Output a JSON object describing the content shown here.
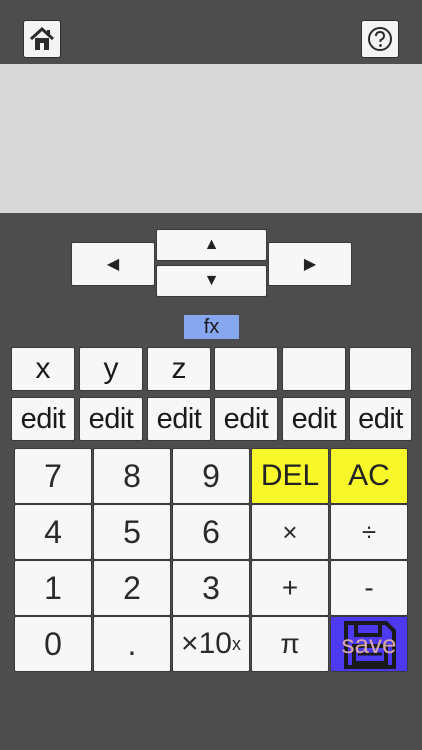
{
  "header": {
    "home_icon": "house-icon",
    "help_icon": "question-circle-icon"
  },
  "display": {
    "text": ""
  },
  "nav": {
    "left": "◀",
    "up": "▲",
    "down": "▼",
    "right": "▶"
  },
  "fx_label": "fx",
  "variables": [
    "x",
    "y",
    "z",
    "",
    "",
    ""
  ],
  "edit_labels": [
    "edit",
    "edit",
    "edit",
    "edit",
    "edit",
    "edit"
  ],
  "keys": {
    "k7": "7",
    "k8": "8",
    "k9": "9",
    "del": "DEL",
    "ac": "AC",
    "k4": "4",
    "k5": "5",
    "k6": "6",
    "mul": "×",
    "div": "÷",
    "k1": "1",
    "k2": "2",
    "k3": "3",
    "add": "+",
    "sub": "-",
    "k0": "0",
    "dot": ".",
    "exp_base": "×10",
    "exp_sup": "x",
    "pi": "π",
    "save": "save"
  },
  "colors": {
    "background": "#4d4d4d",
    "display": "#d8d8d8",
    "fx": "#87a6f0",
    "yellow": "#f7f72a",
    "save": "#4d39f0"
  }
}
